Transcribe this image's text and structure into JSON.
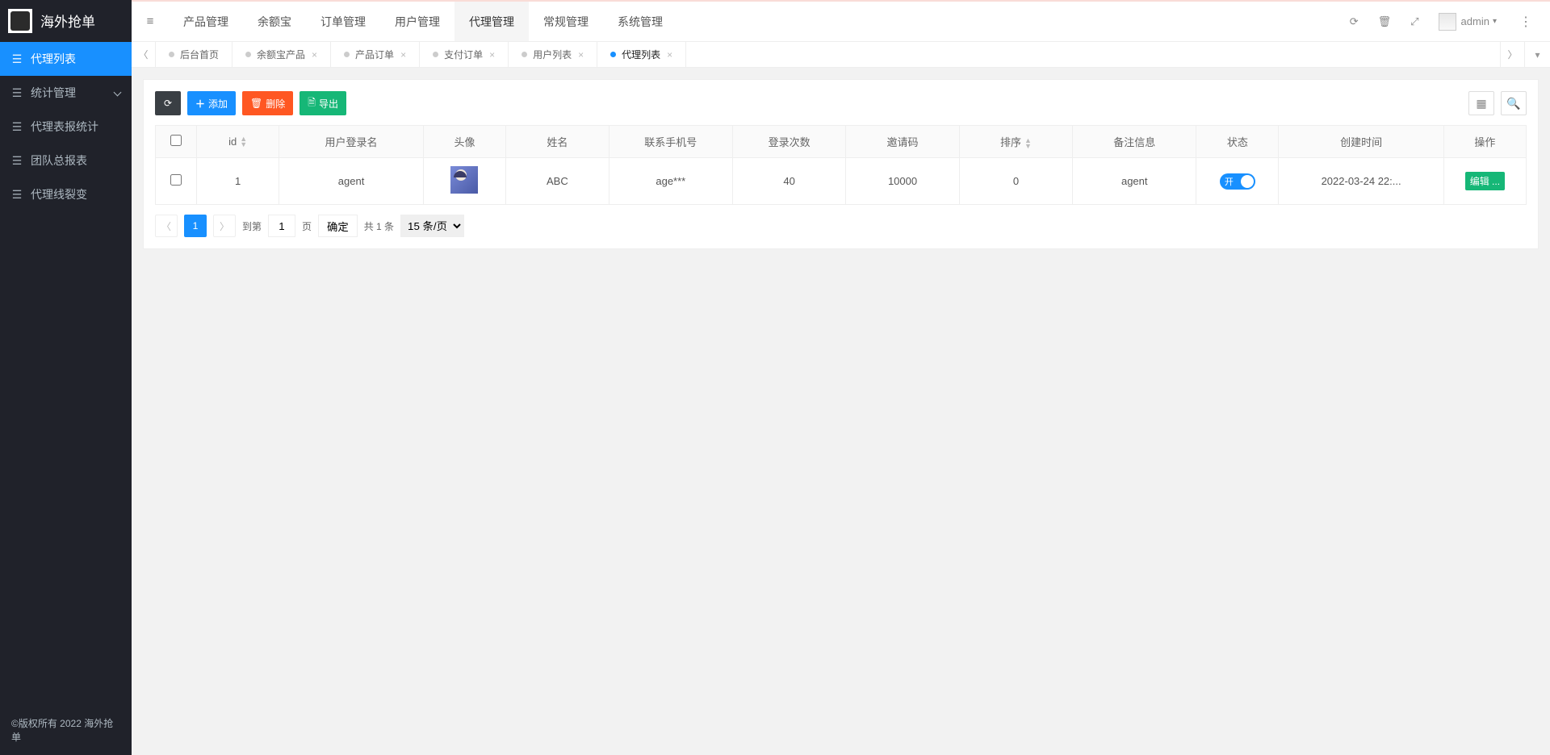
{
  "brand": {
    "title": "海外抢单"
  },
  "sidebar": {
    "items": [
      {
        "label": "代理列表",
        "active": true
      },
      {
        "label": "统计管理",
        "arrow": true
      },
      {
        "label": "代理表报统计"
      },
      {
        "label": "团队总报表"
      },
      {
        "label": "代理线裂变"
      }
    ],
    "copyright": "©版权所有 2022 海外抢单"
  },
  "topnav": {
    "items": [
      {
        "label": "产品管理"
      },
      {
        "label": "余额宝"
      },
      {
        "label": "订单管理"
      },
      {
        "label": "用户管理"
      },
      {
        "label": "代理管理",
        "active": true
      },
      {
        "label": "常规管理"
      },
      {
        "label": "系统管理"
      }
    ]
  },
  "headerUser": {
    "name": "admin"
  },
  "tabs": {
    "items": [
      {
        "label": "后台首页",
        "closable": false
      },
      {
        "label": "余额宝产品",
        "closable": true
      },
      {
        "label": "产品订单",
        "closable": true
      },
      {
        "label": "支付订单",
        "closable": true
      },
      {
        "label": "用户列表",
        "closable": true
      },
      {
        "label": "代理列表",
        "closable": true,
        "active": true
      }
    ]
  },
  "toolbar": {
    "add": "添加",
    "delete": "删除",
    "export": "导出"
  },
  "table": {
    "headers": {
      "id": "id",
      "login": "用户登录名",
      "avatar": "头像",
      "name": "姓名",
      "phone": "联系手机号",
      "logins": "登录次数",
      "invite": "邀请码",
      "sort": "排序",
      "remark": "备注信息",
      "status": "状态",
      "created": "创建时间",
      "ops": "操作"
    },
    "row": {
      "id": "1",
      "login": "agent",
      "name": "ABC",
      "phone": "age***",
      "logins": "40",
      "invite": "10000",
      "sort": "0",
      "remark": "agent",
      "statusText": "开",
      "created": "2022-03-24 22:...",
      "editLabel": "编辑 ..."
    }
  },
  "pager": {
    "page": "1",
    "toPage": "到第",
    "pageWord": "页",
    "ok": "确定",
    "total": "共 1 条",
    "perPage": "15 条/页",
    "inputVal": "1"
  }
}
